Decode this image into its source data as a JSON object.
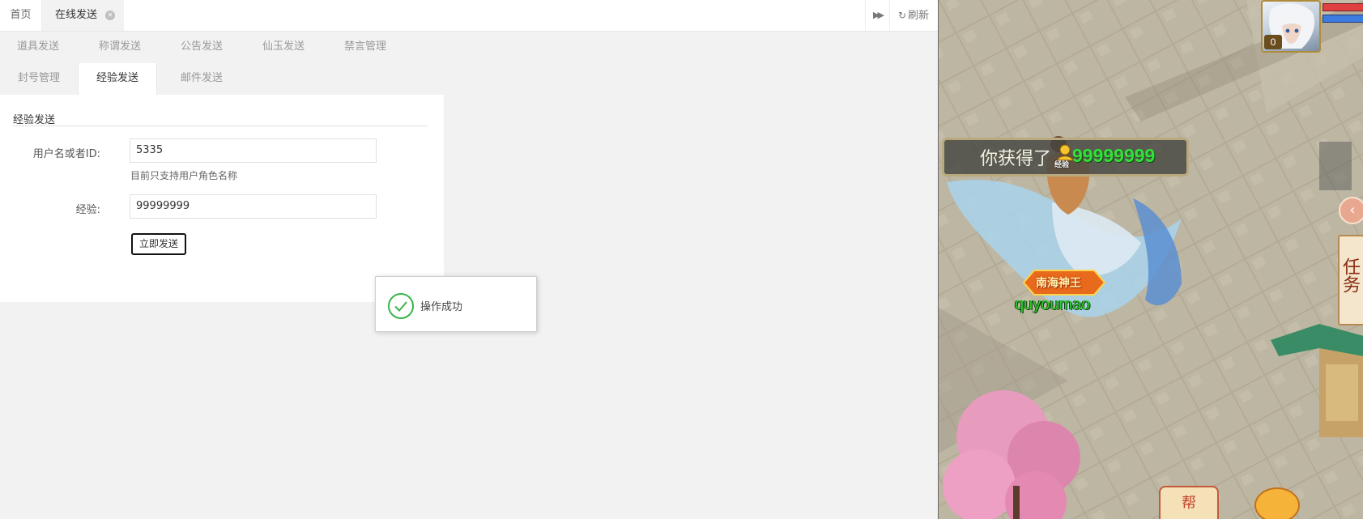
{
  "topbar": {
    "tabs": [
      {
        "label": "首页",
        "active": false
      },
      {
        "label": "在线发送",
        "active": true,
        "close_glyph": "×"
      }
    ],
    "forward_icon": "double-chevron-right-icon",
    "forward_glyph": "▶▶",
    "refresh_glyph": "↻",
    "refresh_label": "刷新"
  },
  "subtabs": {
    "row1": [
      "道具发送",
      "称谓发送",
      "公告发送",
      "仙玉发送",
      "禁言管理"
    ],
    "row2": [
      "封号管理",
      "经验发送",
      "邮件发送"
    ],
    "active": "经验发送"
  },
  "form": {
    "title": "经验发送",
    "username_label": "用户名或者ID:",
    "username_value": "5335",
    "hint": "目前只支持用户角色名称",
    "exp_label": "经验:",
    "exp_value": "99999999",
    "submit_label": "立即发送"
  },
  "toast": {
    "icon": "success-check-icon",
    "text": "操作成功"
  },
  "game": {
    "avatar_level": "0",
    "gain_prefix": "你获得了",
    "exp_icon_label": "经验",
    "gain_value": "99999999",
    "title_badge": "南海神王",
    "player_name": "quyoumao",
    "quest_label": "任务",
    "side_arrow_glyph": "‹",
    "help_label": "帮",
    "colors": {
      "gain_value": "#34e03a",
      "player_name": "#2fcf2f",
      "hp": "#e04040",
      "mp": "#3c7be0"
    }
  }
}
